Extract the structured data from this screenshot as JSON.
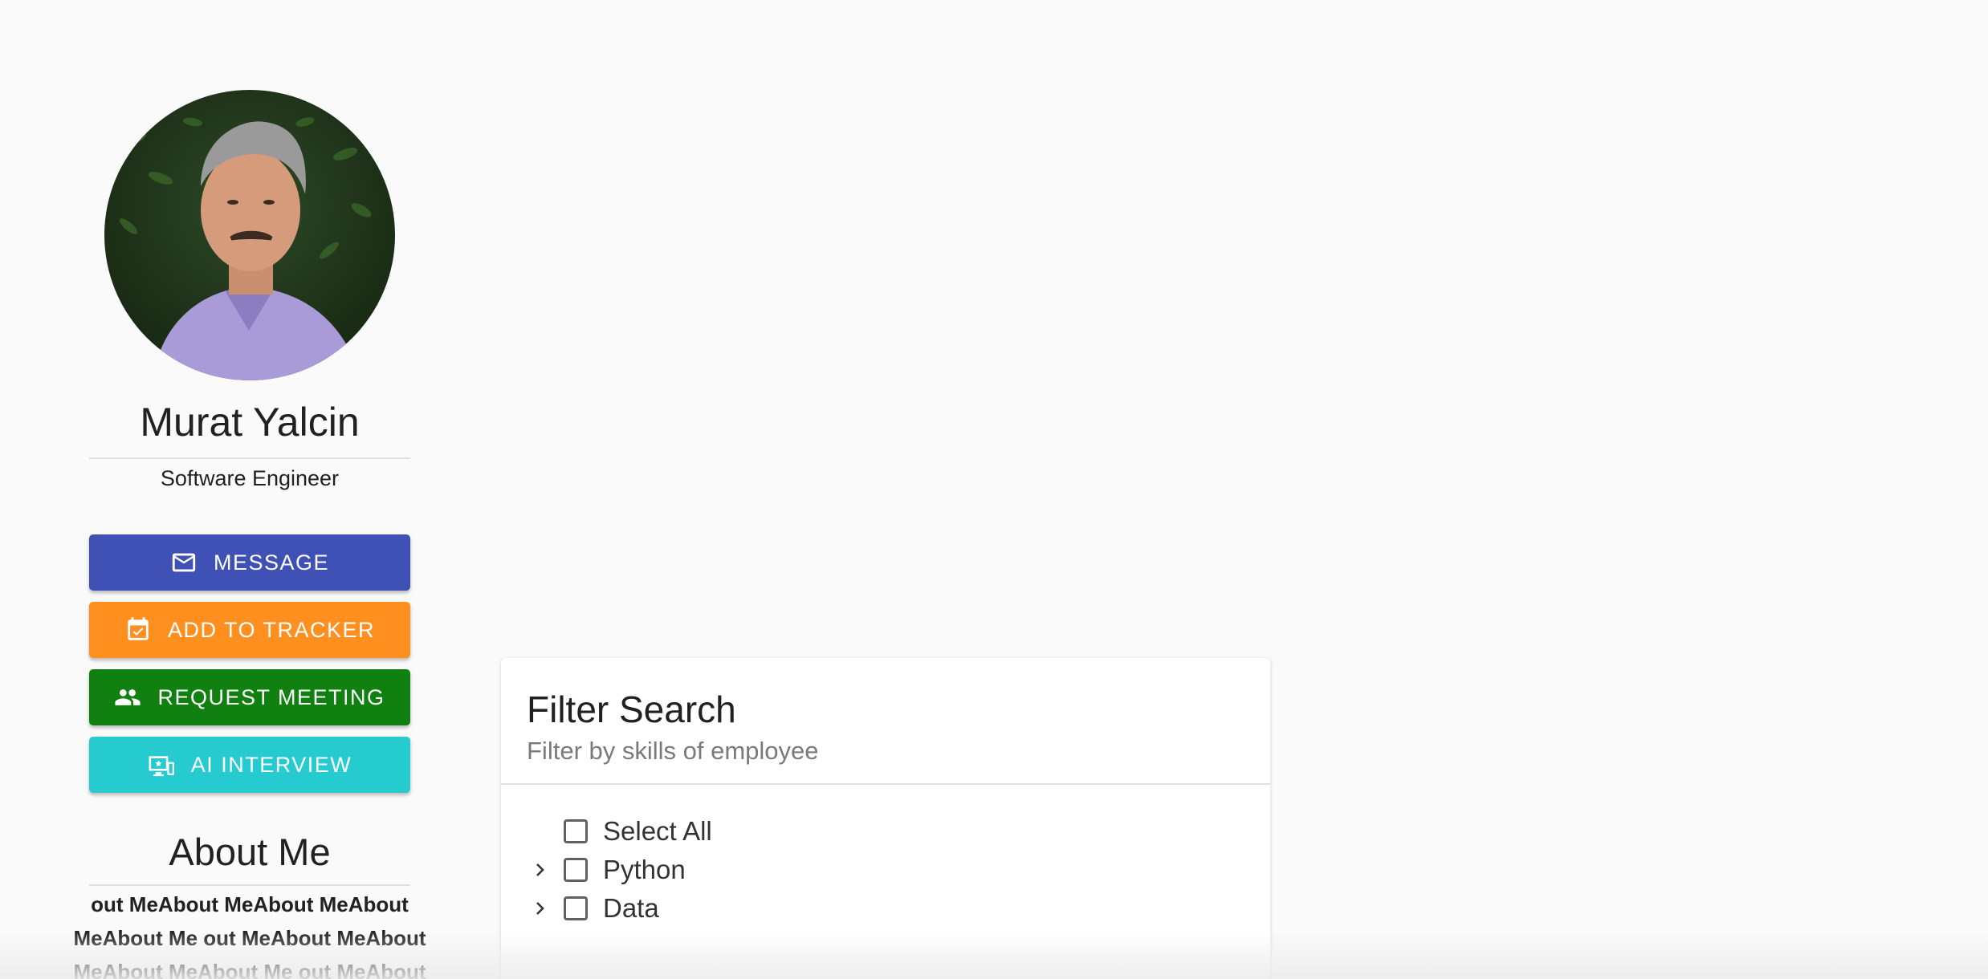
{
  "profile": {
    "name": "Murat Yalcin",
    "role": "Software Engineer"
  },
  "actions": {
    "message_label": "MESSAGE",
    "tracker_label": "ADD TO TRACKER",
    "meeting_label": "REQUEST MEETING",
    "ai_label": "AI INTERVIEW"
  },
  "about": {
    "title": "About Me",
    "text": "out MeAbout MeAbout MeAbout MeAbout Me out MeAbout MeAbout MeAbout MeAbout Me out MeAbout"
  },
  "filter": {
    "title": "Filter Search",
    "subtitle": "Filter by skills of employee",
    "items": [
      {
        "label": "Select All"
      },
      {
        "label": "Python"
      },
      {
        "label": "Data"
      }
    ]
  },
  "colors": {
    "message": "#3f51b5",
    "tracker": "#ff8f1f",
    "meeting": "#108010",
    "ai": "#26cbd0"
  }
}
